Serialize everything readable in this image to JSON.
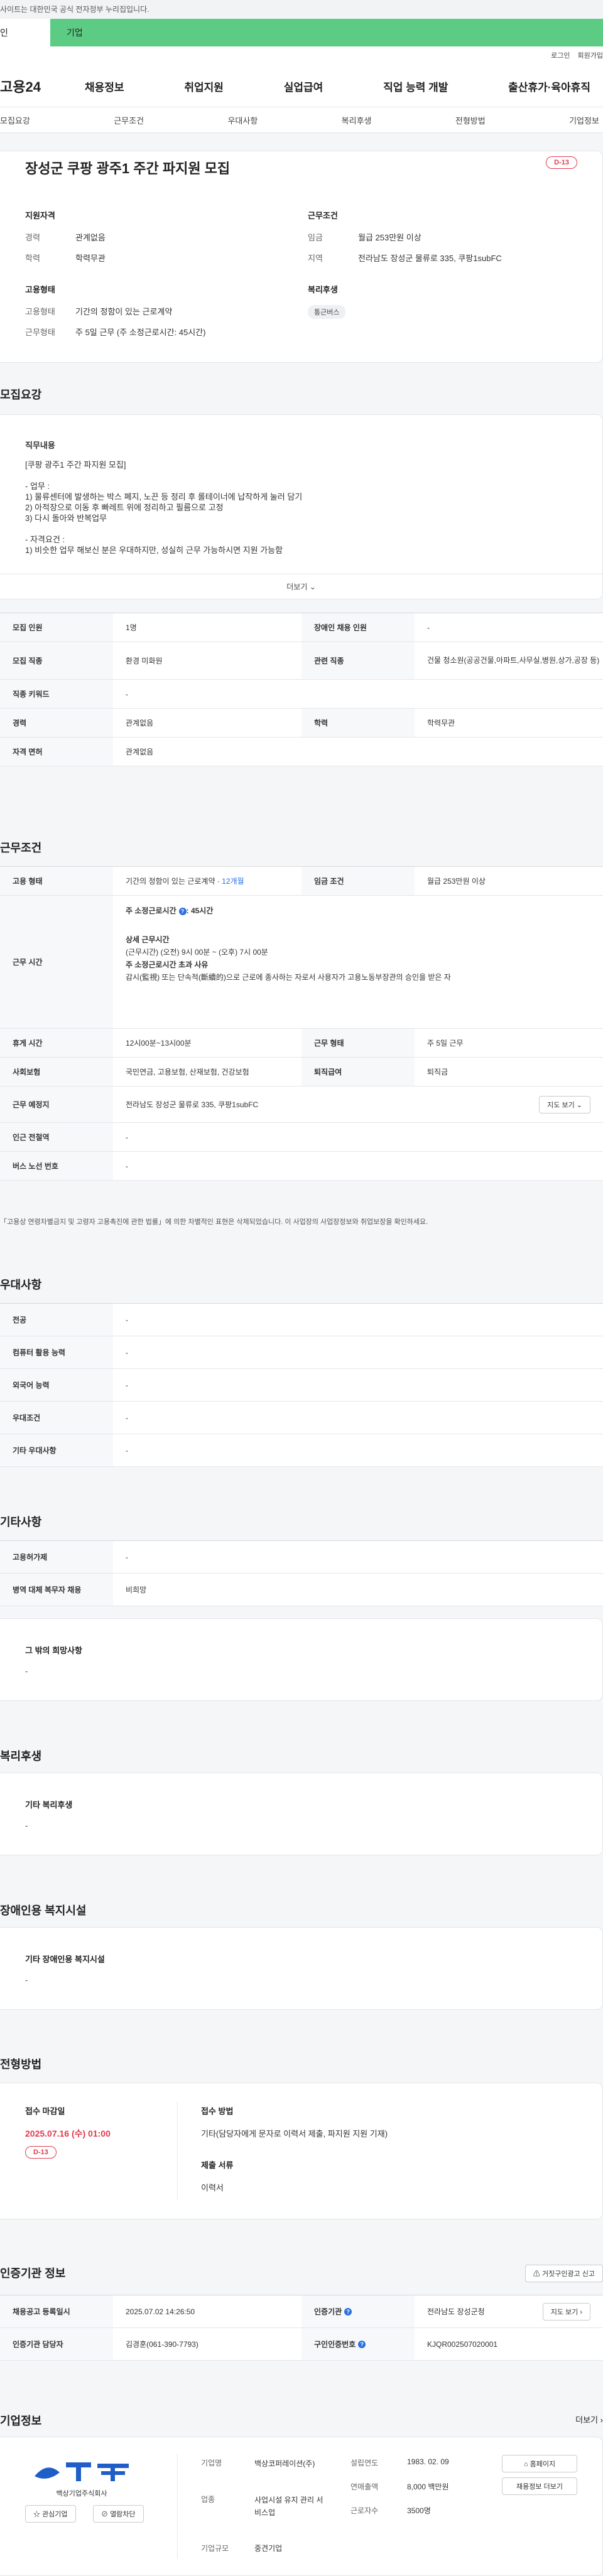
{
  "notice": "사이트는 대한민국 공식 전자정부 누리집입니다.",
  "top_tabs": [
    "인",
    "기업"
  ],
  "util": [
    "로그인",
    "회원가입"
  ],
  "gnb": {
    "logo": "고용24",
    "menu": [
      "채용정보",
      "취업지원",
      "실업급여",
      "직업 능력 개발",
      "출산휴가·육아휴직"
    ]
  },
  "subnav": [
    "모집요강",
    "근무조건",
    "우대사항",
    "복리후생",
    "전형방법",
    "기업정보"
  ],
  "summary": {
    "title": "장성군 쿠팡 광주1 주간 파지원 모집",
    "dday": "D-13",
    "qual": {
      "heading": "지원자격",
      "rows": [
        {
          "k": "경력",
          "v": "관계없음"
        },
        {
          "k": "학력",
          "v": "학력무관"
        }
      ]
    },
    "cond": {
      "heading": "근무조건",
      "rows": [
        {
          "k": "임금",
          "v": "월급 253만원 이상"
        },
        {
          "k": "지역",
          "v": "전라남도 장성군 물류로 335, 쿠팡1subFC"
        }
      ]
    },
    "emp": {
      "heading": "고용형태",
      "rows": [
        {
          "k": "고용형태",
          "v": "기간의 정함이 있는 근로계약"
        },
        {
          "k": "근무형태",
          "v": "주 5일 근무 (주 소정근로시간: 45시간)"
        }
      ]
    },
    "welfare": {
      "heading": "복리후생",
      "badge": "통근버스"
    }
  },
  "recruit": {
    "title": "모집요강",
    "job_heading": "직무내용",
    "lines": [
      "[쿠팡 광주1 주간 파지원 모집]",
      "",
      "- 업무 :",
      "1) 물류센터에 발생하는 박스 폐지, 노끈 등 정리 후 롤테이너에 납작하게 눌러 담기",
      "2) 아적장으로 이동 후 빠레트 위에 정리하고 필름으로 고정",
      "3) 다시 돌아와 반복업무",
      "",
      "- 자격요건 :",
      "1) 비숫한 업무 해보신 분은 우대하지만, 성실히 근무 가능하시면 지원 가능함"
    ],
    "more": "더보기",
    "table": [
      {
        "k1": "모집 인원",
        "v1": "1명",
        "k2": "장애인 채용 인원",
        "v2": "-"
      },
      {
        "k1": "모집 직종",
        "v1": "환경 미화원",
        "k2": "관련 직종",
        "v2": "건물 청소원(공공건물,아파트,사무실,병원,상가,공장 등)"
      },
      {
        "k1": "직종 키워드",
        "v1": "-"
      },
      {
        "k1": "경력",
        "v1": "관계없음",
        "k2": "학력",
        "v2": "학력무관"
      },
      {
        "k1": "자격 면허",
        "v1": "관계없음"
      }
    ]
  },
  "conditions": {
    "title": "근무조건",
    "emp_k": "고용 형태",
    "emp_v": "기간의 정함이 있는 근로계약 · ",
    "emp_v2": "12개월",
    "wage_k": "임금 조건",
    "wage_v": "월급 253만원 이상",
    "time_k": "근무 시간",
    "time_lines": {
      "a": "주 소정근로시간",
      "a2": ": 45시간",
      "b": "상세 근무시간",
      "c": "(근무시간) (오전) 9시 00분 ~ (오후) 7시 00분",
      "d": "주 소정근로시간 초과 사유",
      "e": "감시(監視) 또는 단속적(斷續的)으로 근로에 종사하는 자로서 사용자가 고용노동부장관의 승인을 받은 자"
    },
    "rows": [
      {
        "k1": "휴게 시간",
        "v1": "12시00분~13시00분",
        "k2": "근무 형태",
        "v2": "주 5일 근무"
      },
      {
        "k1": "사회보험",
        "v1": "국민연금, 고용보험, 산재보험, 건강보험",
        "k2": "퇴직급여",
        "v2": "퇴직금"
      }
    ],
    "place_k": "근무 예정지",
    "place_v": "전라남도 장성군 물류로 335, 쿠팡1subFC",
    "map": "지도 보기",
    "station_k": "인근 전철역",
    "station_v": "-",
    "bus_k": "버스 노선 번호",
    "bus_v": "-",
    "note": "「고용상 연령차별금지 및 고령자 고용촉진에 관한 법률」에 의한 차별적인 표현은 삭제되었습니다. 이 사업장의 사업장정보와 취업보장을 확인하세요."
  },
  "prefer": {
    "title": "우대사항",
    "rows": [
      {
        "k": "전공",
        "v": "-"
      },
      {
        "k": "컴퓨터 활용 능력",
        "v": "-"
      },
      {
        "k": "외국어 능력",
        "v": "-"
      },
      {
        "k": "우대조건",
        "v": "-"
      },
      {
        "k": "기타 우대사항",
        "v": "-"
      }
    ]
  },
  "etc": {
    "title": "기타사항",
    "rows": [
      {
        "k": "고용허가제",
        "v": "-"
      },
      {
        "k": "병역 대체 복무자 채용",
        "v": "비희망"
      }
    ],
    "box_t": "그 밖의 희망사항",
    "box_v": "-"
  },
  "welfare": {
    "title": "복리후생",
    "box_t": "기타 복리후생",
    "box_v": "-"
  },
  "disabled": {
    "title": "장애인용 복지시설",
    "box_t": "기타 장애인용 복지시설",
    "box_v": "-"
  },
  "selection": {
    "title": "전형방법",
    "deadline_t": "접수 마감일",
    "deadline_v": "2025.07.16 (수) 01:00",
    "dday": "D-13",
    "method_t": "접수 방법",
    "method_v": "기타(담당자에게 문자로 이력서 제출, 파지원 지원 기재)",
    "doc_t": "제출 서류",
    "doc_v": "이력서"
  },
  "agency": {
    "title": "인증기관 정보",
    "report": "거짓구인광고 신고",
    "rows": [
      {
        "k1": "채용공고 등록일시",
        "v1": "2025.07.02 14:26:50",
        "k2": "인증기관",
        "v2": "전라남도 장성군청",
        "btn": "지도 보기"
      },
      {
        "k1": "인증기관 담당자",
        "v1": "김경훈(061-390-7793)",
        "k2": "구인인증번호",
        "v2": "KJQR002507020001"
      }
    ]
  },
  "company": {
    "title": "기업정보",
    "more": "더보기",
    "logo_name": "백상기업주식회사",
    "interest": "관심기업",
    "block": "열람차단",
    "rows": [
      {
        "k": "기업명",
        "v": "백상코퍼레이션(주)",
        "k2": "설립연도",
        "v2": "1983. 02. 09"
      },
      {
        "k": "업종",
        "v": "사업시설 유지 관리 서비스업",
        "k2": "연매출액",
        "v2": "8,000 백만원"
      },
      {
        "k": "",
        "v": "",
        "k2": "근로자수",
        "v2": "3500명"
      },
      {
        "k": "기업규모",
        "v": "중견기업",
        "k2": "",
        "v2": ""
      }
    ],
    "home": "홈페이지",
    "jobs": "채용정보 더보기"
  }
}
